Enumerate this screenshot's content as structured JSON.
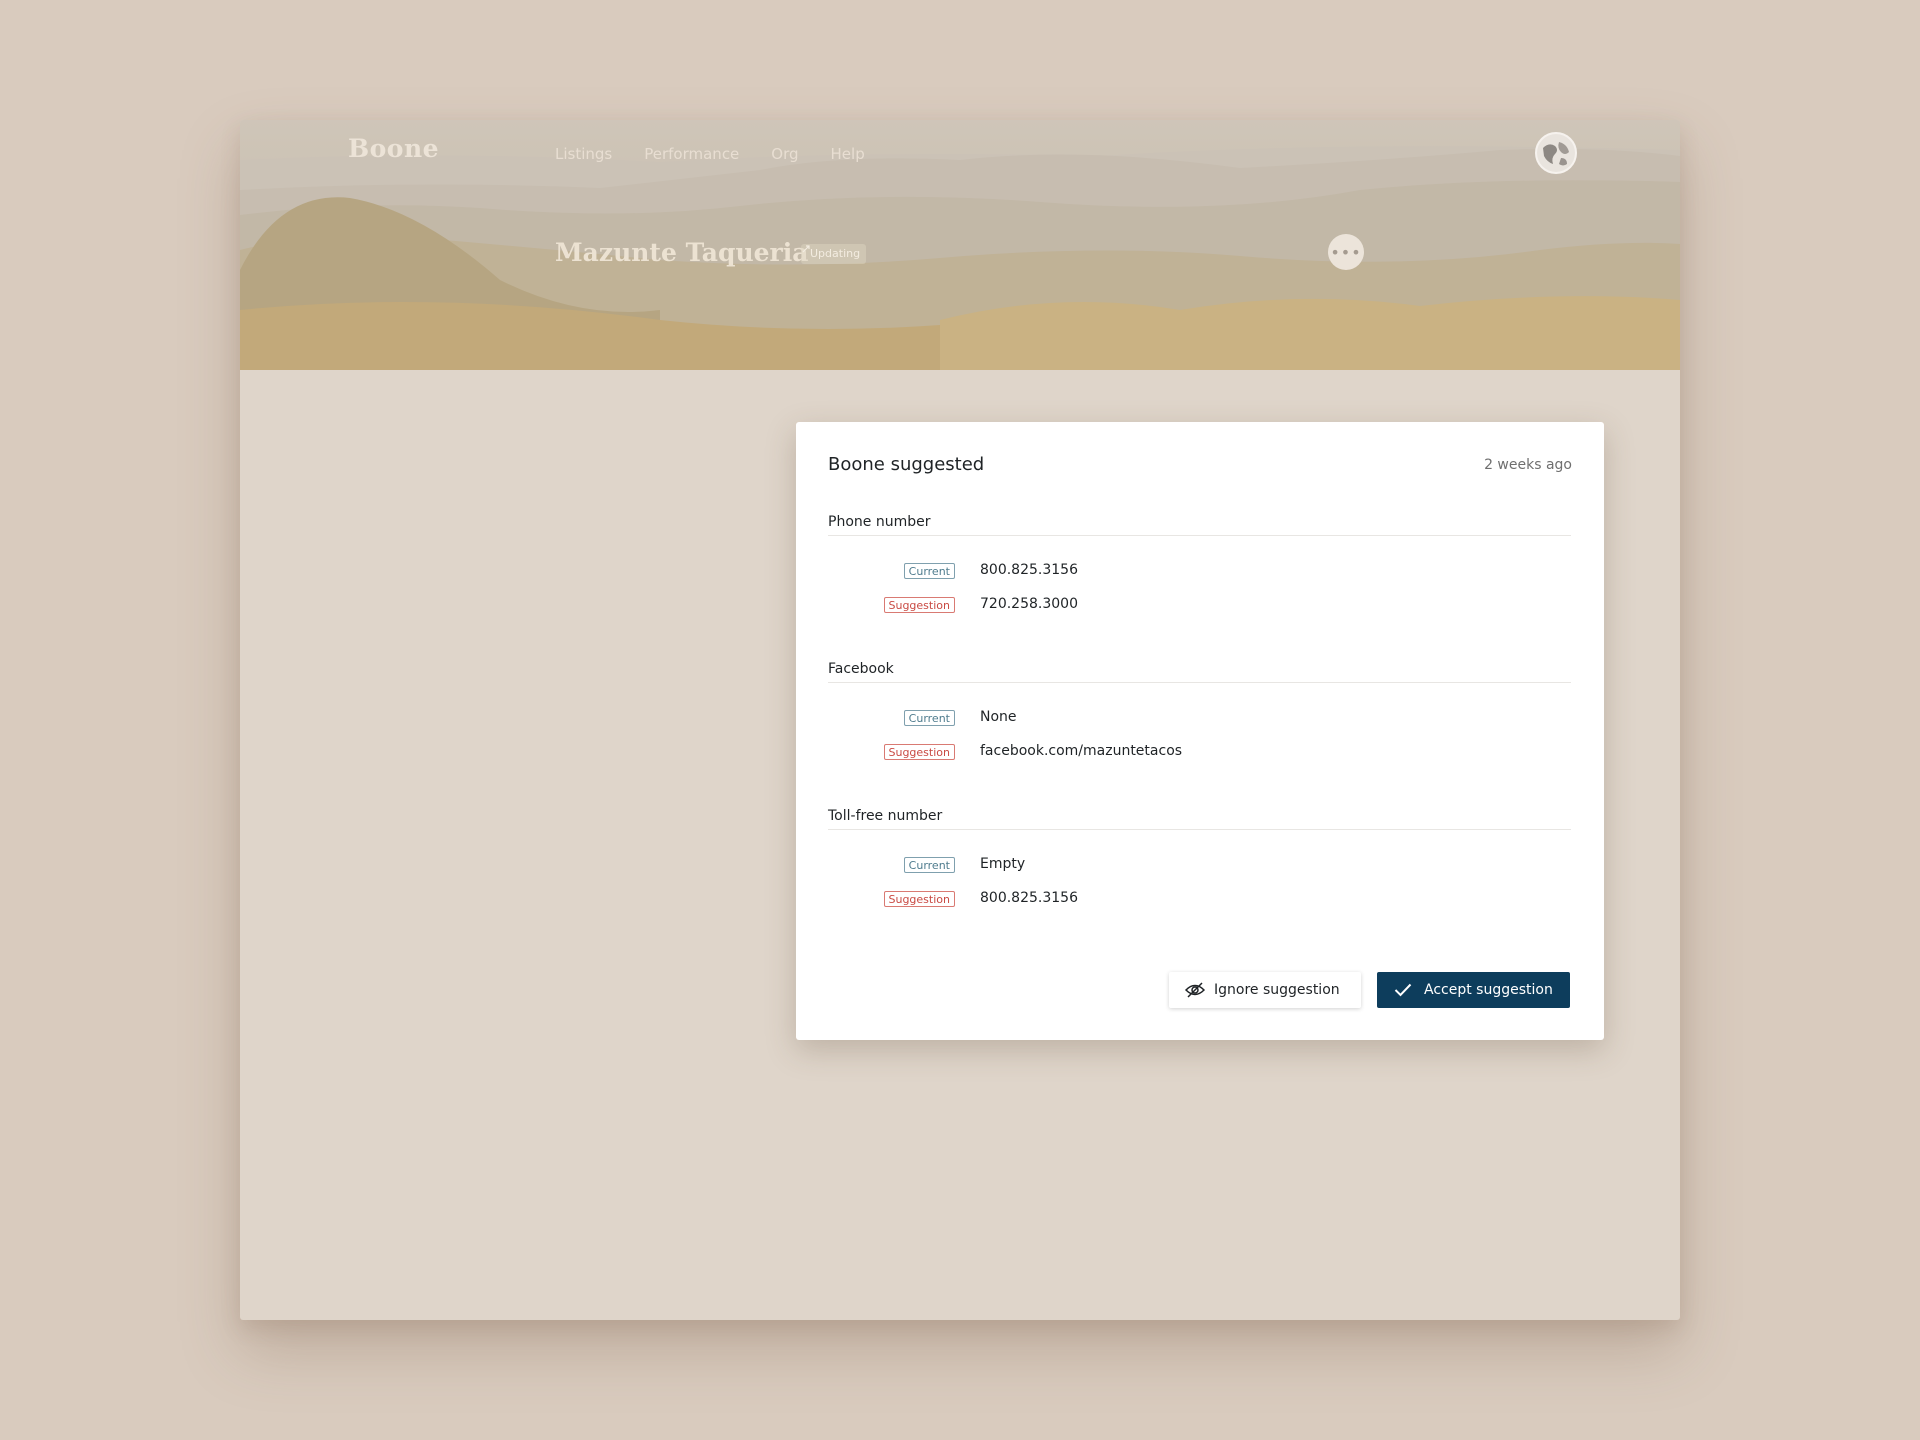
{
  "app": {
    "brand": "Boone",
    "nav": [
      "Listings",
      "Performance",
      "Org",
      "Help"
    ]
  },
  "listing": {
    "name": "Mazunte Taqueria",
    "status_badge": "Updating",
    "more_icon": "ellipsis-icon"
  },
  "modal": {
    "title": "Boone suggested",
    "timestamp": "2 weeks ago",
    "current_tag": "Current",
    "suggestion_tag": "Suggestion",
    "sections": [
      {
        "label": "Phone number",
        "current": "800.825.3156",
        "suggestion": "720.258.3000"
      },
      {
        "label": "Facebook",
        "current": "None",
        "suggestion": "facebook.com/mazuntetacos"
      },
      {
        "label": "Toll-free number",
        "current": "Empty",
        "suggestion": "800.825.3156"
      }
    ],
    "ignore_button": {
      "label": "Ignore suggestion",
      "icon": "eye-slash-icon"
    },
    "accept_button": {
      "label": "Accept suggestion",
      "icon": "check-icon"
    }
  },
  "colors": {
    "page_bg": "#d9cbbe",
    "accent_button": "#0d3d5c",
    "current_tag": "#4f7c8e",
    "suggestion_tag": "#c94a43"
  }
}
